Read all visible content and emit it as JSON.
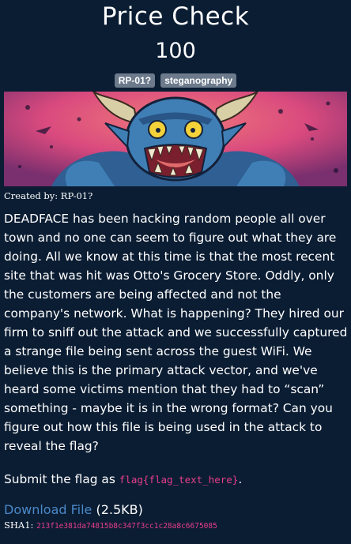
{
  "challenge": {
    "title": "Price Check",
    "points": "100",
    "tags": [
      "RP-01?",
      "steganography"
    ],
    "created_by_label": "Created by:",
    "author": "RP-01?",
    "description": "DEADFACE has been hacking random people all over town and no one can seem to figure out what they are doing. All we know at this time is that the most recent site that was hit was Otto's Grocery Store. Oddly, only the customers are being affected and not the company's network. What is happening? They hired our firm to sniff out the attack and we successfully captured a strange file being sent across the guest WiFi. We believe this is the primary attack vector, and we've heard some victims mention that they had to “scan” something - maybe it is in the wrong format? Can you figure out how this file is being used in the attack to reveal the flag?",
    "submit_prefix": "Submit the flag as",
    "flag_format": "flag{flag_text_here}",
    "submit_suffix": ".",
    "download_label": "Download File",
    "file_size": "(2.5KB)",
    "sha1_label": "SHA1:",
    "sha1": "213f1e381da74815b8c347f3cc1c28a8c6675085"
  },
  "banner": {
    "image": "monster-illustration",
    "colors": {
      "background": "#d94a7e",
      "skin": "#3f7fb5",
      "eyes": "#f3d23a",
      "horns": "#d9cfa6"
    }
  },
  "colors": {
    "page_bg": "#0b1d33",
    "tag_bg": "#6c7a8c",
    "link": "#4a89c8",
    "code": "#e83e8c"
  }
}
